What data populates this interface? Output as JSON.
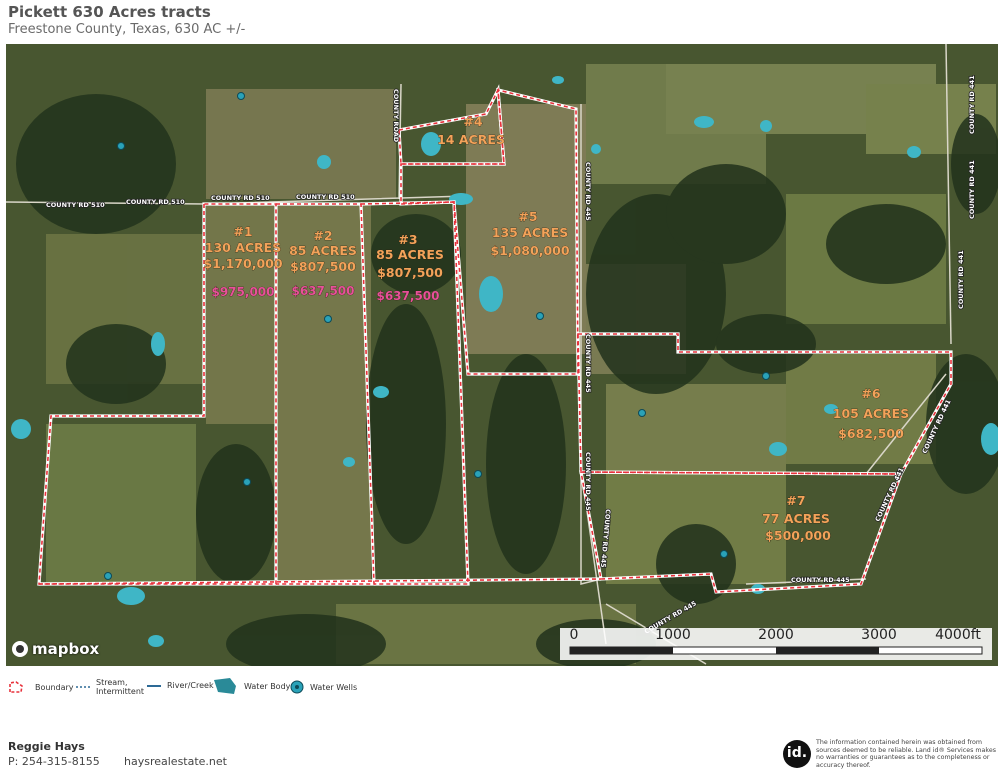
{
  "header": {
    "title": "Pickett 630 Acres tracts",
    "subtitle": "Freestone County, Texas, 630 AC +/-"
  },
  "map": {
    "attribution": "mapbox",
    "roads": {
      "county_rd_510": "COUNTY RD 510",
      "county_rd_445": "COUNTY RD 445",
      "county_rd_441": "COUNTY RD 441",
      "county_road": "COUNTY ROAD"
    },
    "tracts": [
      {
        "number": "#1",
        "acres": "130 ACRES",
        "price": "$1,170,000",
        "alt_price": "$975,000"
      },
      {
        "number": "#2",
        "acres": "85 ACRES",
        "price": "$807,500",
        "alt_price": "$637,500"
      },
      {
        "number": "#3",
        "acres": "85 ACRES",
        "price": "$807,500",
        "alt_price": "$637,500"
      },
      {
        "number": "#4",
        "acres": "14 ACRES"
      },
      {
        "number": "#5",
        "acres": "135 ACRES",
        "price": "$1,080,000"
      },
      {
        "number": "#6",
        "acres": "105 ACRES",
        "price": "$682,500"
      },
      {
        "number": "#7",
        "acres": "77 ACRES",
        "price": "$500,000"
      }
    ],
    "scale_bar": {
      "ticks": [
        "0",
        "1000",
        "2000",
        "3000",
        "4000ft"
      ]
    },
    "colors": {
      "boundary": "#e8323c",
      "water": "#3fb6c6",
      "label": "#f2a35a",
      "alt_price": "#e8519a"
    }
  },
  "legend": {
    "boundary": "Boundary",
    "stream": "Stream, Intermittent",
    "river": "River/Creek",
    "water_body": "Water Body",
    "water_wells": "Water Wells"
  },
  "footer": {
    "agent_name": "Reggie Hays",
    "phone": "P: 254-315-8155",
    "website": "haysrealestate.net",
    "logo": "id.",
    "disclaimer": "The information contained herein was obtained from sources deemed to be reliable. Land id® Services makes no warranties or guarantees as to the completeness or accuracy thereof."
  }
}
